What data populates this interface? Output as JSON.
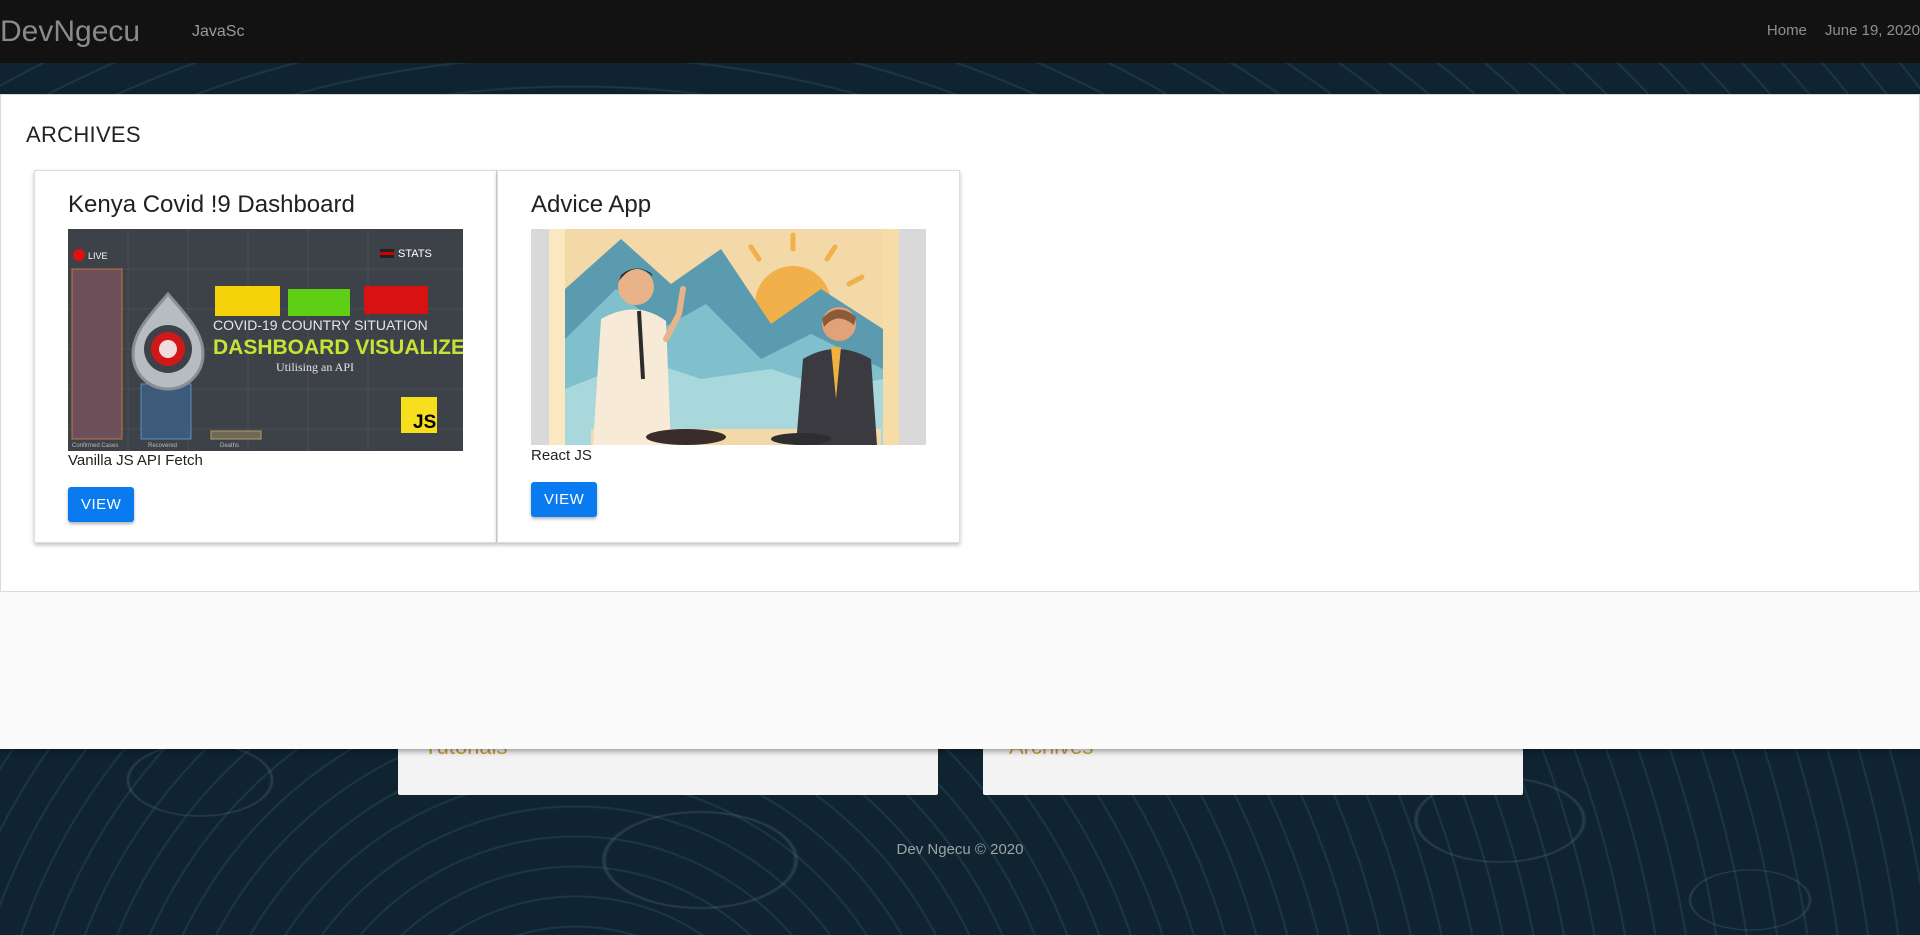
{
  "navbar": {
    "brand": "DevNgecu",
    "search_value": "JavaSc",
    "links": [
      "Home",
      "June 19, 2020"
    ]
  },
  "background": {
    "cards": [
      {
        "title": "Tutorials"
      },
      {
        "title": "Archives"
      }
    ],
    "footer": "Dev Ngecu © 2020"
  },
  "archives": {
    "title": "ARCHIVES",
    "cards": [
      {
        "title": "Kenya Covid !9 Dashboard",
        "tech": "Vanilla JS API Fetch",
        "button": "VIEW",
        "thumb": {
          "live": "LIVE",
          "stats": "STATS",
          "line1": "COVID-19 COUNTRY SITUATION",
          "line2": "DASHBOARD VISUALIZER",
          "line3": "Utilising an API",
          "badge": "JS",
          "bar_labels": [
            "Confirmed Cases",
            "Recovered",
            "Deaths"
          ]
        }
      },
      {
        "title": "Advice App",
        "tech": "React JS",
        "button": "VIEW"
      }
    ]
  },
  "colors": {
    "navbar_bg": "#121212",
    "primary_button": "#0a7af0",
    "accent_gold": "#c89b3c"
  }
}
